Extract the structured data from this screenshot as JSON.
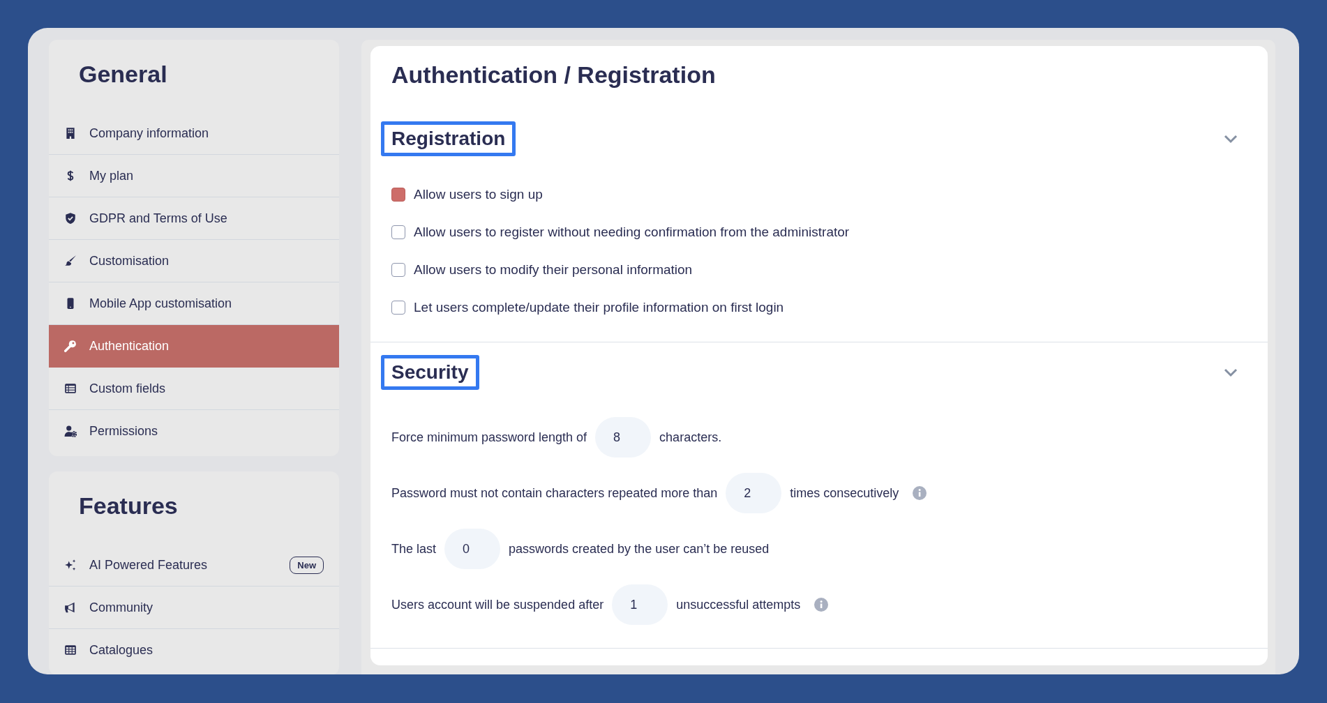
{
  "sidebar": {
    "groups": [
      {
        "title": "General",
        "items": [
          {
            "label": "Company information",
            "selected": false
          },
          {
            "label": "My plan",
            "selected": false
          },
          {
            "label": "GDPR and Terms of Use",
            "selected": false
          },
          {
            "label": "Customisation",
            "selected": false
          },
          {
            "label": "Mobile App customisation",
            "selected": false
          },
          {
            "label": "Authentication",
            "selected": true
          },
          {
            "label": "Custom fields",
            "selected": false
          },
          {
            "label": "Permissions",
            "selected": false
          }
        ]
      },
      {
        "title": "Features",
        "items": [
          {
            "label": "AI Powered Features",
            "selected": false,
            "badge": "New"
          },
          {
            "label": "Community",
            "selected": false
          },
          {
            "label": "Catalogues",
            "selected": false
          }
        ]
      }
    ]
  },
  "page_title": "Authentication / Registration",
  "sections": [
    {
      "title": "Registration",
      "highlighted": true,
      "expanded": true,
      "kind": "checkboxes",
      "options": [
        {
          "label": "Allow users to sign up",
          "checked": true
        },
        {
          "label": "Allow users to register without needing confirmation from the administrator",
          "checked": false
        },
        {
          "label": "Allow users to modify their personal information",
          "checked": false
        },
        {
          "label": "Let users complete/update their profile information on first login",
          "checked": false
        }
      ]
    },
    {
      "title": "Security",
      "highlighted": true,
      "expanded": true,
      "kind": "sentences",
      "rows": [
        {
          "before": "Force minimum password length of",
          "value": "8",
          "after": "characters.",
          "info": false
        },
        {
          "before": "Password must not contain characters repeated more than",
          "value": "2",
          "after": "times consecutively",
          "info": true
        },
        {
          "before": "The last",
          "value": "0",
          "after": "passwords created by the user can’t be reused",
          "info": false
        },
        {
          "before": "Users account will be suspended after",
          "value": "1",
          "after": "unsuccessful attempts",
          "info": true
        }
      ]
    }
  ]
}
